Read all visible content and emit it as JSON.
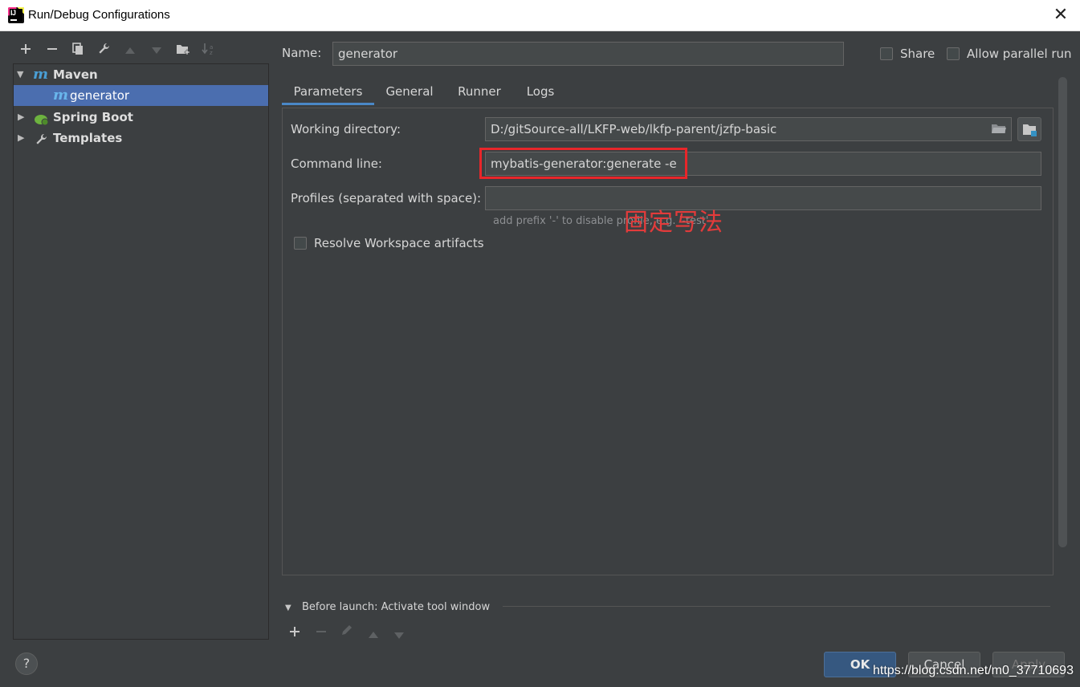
{
  "window": {
    "title": "Run/Debug Configurations",
    "close_glyph": "✕"
  },
  "toolbar": {
    "icons": [
      "add-icon",
      "remove-icon",
      "copy-icon",
      "wrench-icon",
      "move-up-icon",
      "move-down-icon",
      "new-folder-icon",
      "sort-icon"
    ]
  },
  "tree": {
    "items": [
      {
        "label": "Maven",
        "icon": "maven-icon",
        "expanded": true
      },
      {
        "label": "generator",
        "icon": "maven-icon",
        "selected": true
      },
      {
        "label": "Spring Boot",
        "icon": "spring-boot-icon",
        "expanded": false
      },
      {
        "label": "Templates",
        "icon": "wrench-icon",
        "expanded": false
      }
    ],
    "maven_glyph": "m"
  },
  "config": {
    "name_label": "Name:",
    "name_value": "generator",
    "share_label": "Share",
    "allow_parallel_label": "Allow parallel run"
  },
  "tabs": [
    "Parameters",
    "General",
    "Runner",
    "Logs"
  ],
  "params": {
    "working_dir_label": "Working directory:",
    "working_dir_value": "D:/gitSource-all/LKFP-web/lkfp-parent/jzfp-basic",
    "command_line_label": "Command line:",
    "command_line_value": "mybatis-generator:generate -e",
    "profiles_label": "Profiles (separated with space):",
    "profiles_value": "",
    "profiles_hint": "add prefix '-' to disable profile, e.g. '-test'",
    "resolve_label": "Resolve Workspace artifacts"
  },
  "annotation": {
    "text": "固定写法",
    "color": "#e33b3b"
  },
  "before_launch": {
    "label": "Before launch: Activate tool window"
  },
  "buttons": {
    "ok": "OK",
    "cancel": "Cancel",
    "apply": "Apply",
    "help": "?"
  },
  "watermark": "https://blog.csdn.net/m0_37710693",
  "colors": {
    "selection": "#4b6eaf",
    "accent_tab": "#4a88c7",
    "background": "#3c3f41",
    "highlight_box": "#e8262a"
  }
}
